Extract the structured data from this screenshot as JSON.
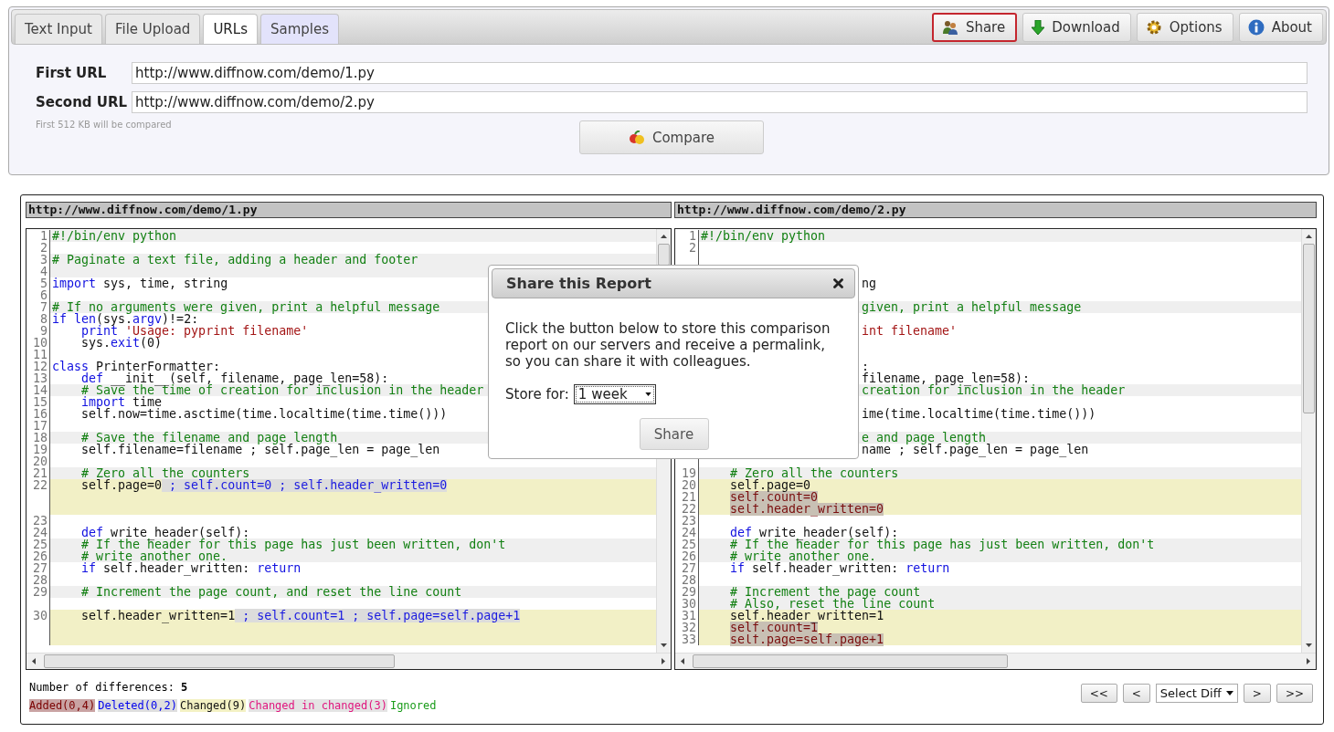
{
  "tabs": [
    {
      "label": "Text Input",
      "selected": false,
      "hovered": false
    },
    {
      "label": "File Upload",
      "selected": false,
      "hovered": false
    },
    {
      "label": "URLs",
      "selected": true,
      "hovered": false
    },
    {
      "label": "Samples",
      "selected": false,
      "hovered": true
    }
  ],
  "actions": [
    {
      "kind": "share",
      "label": "Share",
      "highlighted": true
    },
    {
      "kind": "download",
      "label": "Download",
      "highlighted": false
    },
    {
      "kind": "options",
      "label": "Options",
      "highlighted": false
    },
    {
      "kind": "about",
      "label": "About",
      "highlighted": false
    }
  ],
  "url_form": {
    "fields": [
      {
        "label": "First URL",
        "value": "http://www.diffnow.com/demo/1.py"
      },
      {
        "label": "Second URL",
        "value": "http://www.diffnow.com/demo/2.py"
      }
    ],
    "note": "First 512 KB will be compared",
    "compare_button": "Compare"
  },
  "panels": [
    {
      "title": "http://www.diffnow.com/demo/1.py",
      "rows": [
        {
          "num": "1",
          "kind": "comment",
          "segs": [
            {
              "kind": "comment",
              "text": "#!/bin/env python"
            }
          ]
        },
        {
          "num": "2",
          "kind": "plain"
        },
        {
          "num": "3",
          "kind": "comment",
          "segs": [
            {
              "kind": "comment",
              "text": "# Paginate a text file, adding a header and footer"
            }
          ]
        },
        {
          "num": "4",
          "kind": "comment"
        },
        {
          "num": "5",
          "kind": "plain",
          "segs": [
            {
              "kind": "keyword",
              "text": "import"
            },
            {
              "kind": "plain",
              "text": " sys, time, string"
            }
          ]
        },
        {
          "num": "6",
          "kind": "plain"
        },
        {
          "num": "7",
          "kind": "comment",
          "segs": [
            {
              "kind": "comment",
              "text": "# If no arguments were given, print a helpful message"
            }
          ]
        },
        {
          "num": "8",
          "kind": "plain",
          "segs": [
            {
              "kind": "keyword",
              "text": "if len"
            },
            {
              "kind": "plain",
              "text": "(sys."
            },
            {
              "kind": "keyword",
              "text": "argv"
            },
            {
              "kind": "plain",
              "text": ")!=2:"
            }
          ]
        },
        {
          "num": "9",
          "kind": "plain",
          "segs": [
            {
              "kind": "keyword",
              "text": "    print"
            },
            {
              "kind": "string",
              "text": " 'Usage: pyprint filename'"
            }
          ]
        },
        {
          "num": "10",
          "kind": "plain",
          "segs": [
            {
              "kind": "plain",
              "text": "    sys."
            },
            {
              "kind": "keyword",
              "text": "exit"
            },
            {
              "kind": "plain",
              "text": "(0)"
            }
          ]
        },
        {
          "num": "11",
          "kind": "plain"
        },
        {
          "num": "12",
          "kind": "plain",
          "segs": [
            {
              "kind": "keyword",
              "text": "class"
            },
            {
              "kind": "plain",
              "text": " PrinterFormatter:"
            }
          ]
        },
        {
          "num": "13",
          "kind": "plain",
          "segs": [
            {
              "kind": "keyword",
              "text": "    def"
            },
            {
              "kind": "plain",
              "text": " __init__(self, filename, page_len=58):"
            }
          ]
        },
        {
          "num": "14",
          "kind": "comment",
          "segs": [
            {
              "kind": "comment",
              "text": "    # Save the time of creation for inclusion in the header"
            }
          ]
        },
        {
          "num": "15",
          "kind": "plain",
          "segs": [
            {
              "kind": "keyword",
              "text": "    import"
            },
            {
              "kind": "plain",
              "text": " time"
            }
          ]
        },
        {
          "num": "16",
          "kind": "plain",
          "segs": [
            {
              "kind": "plain",
              "text": "    self.now=time.asctime(time.localtime(time.time()))"
            }
          ]
        },
        {
          "num": "17",
          "kind": "plain"
        },
        {
          "num": "18",
          "kind": "comment",
          "segs": [
            {
              "kind": "comment",
              "text": "    # Save the filename and page length"
            }
          ]
        },
        {
          "num": "19",
          "kind": "plain",
          "segs": [
            {
              "kind": "plain",
              "text": "    self.filename=filename ; self.page_len = page_len"
            }
          ]
        },
        {
          "num": "20",
          "kind": "plain"
        },
        {
          "num": "21",
          "kind": "comment",
          "segs": [
            {
              "kind": "comment",
              "text": "    # Zero all the counters"
            }
          ]
        },
        {
          "num": "22",
          "kind": "changed",
          "segs": [
            {
              "kind": "plain",
              "text": "    self.page=0"
            },
            {
              "kind": "deleted",
              "text": " ; self.count=0 ; self.header_written=0"
            }
          ]
        },
        {
          "kind": "changed"
        },
        {
          "kind": "changed"
        },
        {
          "num": "23",
          "kind": "plain"
        },
        {
          "num": "24",
          "kind": "plain",
          "segs": [
            {
              "kind": "keyword",
              "text": "    def"
            },
            {
              "kind": "plain",
              "text": " write_header(self):"
            }
          ]
        },
        {
          "num": "25",
          "kind": "comment",
          "segs": [
            {
              "kind": "comment",
              "text": "    # If the header for this page has just been written, don't"
            }
          ]
        },
        {
          "num": "26",
          "kind": "comment",
          "segs": [
            {
              "kind": "comment",
              "text": "    # write another one."
            }
          ]
        },
        {
          "num": "27",
          "kind": "plain",
          "segs": [
            {
              "kind": "keyword",
              "text": "    if"
            },
            {
              "kind": "plain",
              "text": " self.header_written: "
            },
            {
              "kind": "keyword",
              "text": "return"
            }
          ]
        },
        {
          "num": "28",
          "kind": "plain"
        },
        {
          "num": "29",
          "kind": "comment",
          "segs": [
            {
              "kind": "comment",
              "text": "    # Increment the page count, and reset the line count"
            }
          ]
        },
        {
          "kind": "plain"
        },
        {
          "num": "30",
          "kind": "changed",
          "segs": [
            {
              "kind": "plain",
              "text": "    self.header_written=1"
            },
            {
              "kind": "deleted",
              "text": " ; self.count=1 ; self.page=self.page+1"
            }
          ]
        },
        {
          "kind": "changed"
        },
        {
          "kind": "changed"
        }
      ]
    },
    {
      "title": "http://www.diffnow.com/demo/2.py",
      "rows": [
        {
          "num": "1",
          "kind": "comment",
          "segs": [
            {
              "kind": "comment",
              "text": "#!/bin/env python"
            }
          ]
        },
        {
          "num": "2",
          "kind": "plain"
        },
        {
          "kind": "plain"
        },
        {
          "kind": "plain"
        },
        {
          "clipped": true,
          "kind": "plain",
          "segs": [
            {
              "kind": "plain",
              "text": "ng"
            }
          ]
        },
        {
          "kind": "plain"
        },
        {
          "clipped": true,
          "kind": "comment",
          "segs": [
            {
              "kind": "comment",
              "text": "given, print a helpful message"
            }
          ]
        },
        {
          "kind": "plain"
        },
        {
          "clipped": true,
          "kind": "plain",
          "segs": [
            {
              "kind": "string",
              "text": "int filename'"
            }
          ]
        },
        {
          "kind": "plain"
        },
        {
          "kind": "plain"
        },
        {
          "clipped": true,
          "kind": "plain",
          "segs": [
            {
              "kind": "plain",
              "text": ":"
            }
          ]
        },
        {
          "clipped": true,
          "kind": "plain",
          "segs": [
            {
              "kind": "plain",
              "text": "filename, page_len=58):"
            }
          ]
        },
        {
          "clipped": true,
          "kind": "comment",
          "segs": [
            {
              "kind": "comment",
              "text": "creation for inclusion in the header"
            }
          ]
        },
        {
          "kind": "plain"
        },
        {
          "clipped": true,
          "kind": "plain",
          "segs": [
            {
              "kind": "plain",
              "text": "ime(time.localtime(time.time()))"
            }
          ]
        },
        {
          "kind": "plain"
        },
        {
          "clipped": true,
          "kind": "comment",
          "segs": [
            {
              "kind": "comment",
              "text": "e and page length"
            }
          ]
        },
        {
          "clipped": true,
          "kind": "plain",
          "segs": [
            {
              "kind": "plain",
              "text": "name ; self.page_len = page_len"
            }
          ]
        },
        {
          "kind": "plain"
        },
        {
          "num": "19",
          "kind": "comment",
          "segs": [
            {
              "kind": "comment",
              "text": "    # Zero all the counters"
            }
          ]
        },
        {
          "num": "20",
          "kind": "changed",
          "segs": [
            {
              "kind": "plain",
              "text": "    self.page=0"
            }
          ]
        },
        {
          "num": "21",
          "kind": "changed",
          "indented": true,
          "segs": [
            {
              "kind": "added",
              "text": "self.count=0"
            }
          ]
        },
        {
          "num": "22",
          "kind": "changed",
          "indented": true,
          "segs": [
            {
              "kind": "added",
              "text": "self.header_written=0"
            }
          ]
        },
        {
          "num": "23",
          "kind": "plain"
        },
        {
          "num": "24",
          "kind": "plain",
          "segs": [
            {
              "kind": "keyword",
              "text": "    def"
            },
            {
              "kind": "plain",
              "text": " write_header(self):"
            }
          ]
        },
        {
          "num": "25",
          "kind": "comment",
          "segs": [
            {
              "kind": "comment",
              "text": "    # If the header for this page has just been written, don't"
            }
          ]
        },
        {
          "num": "26",
          "kind": "comment",
          "segs": [
            {
              "kind": "comment",
              "text": "    # write another one."
            }
          ]
        },
        {
          "num": "27",
          "kind": "plain",
          "segs": [
            {
              "kind": "keyword",
              "text": "    if"
            },
            {
              "kind": "plain",
              "text": " self.header_written: "
            },
            {
              "kind": "keyword",
              "text": "return"
            }
          ]
        },
        {
          "num": "28",
          "kind": "plain"
        },
        {
          "num": "29",
          "kind": "comment",
          "segs": [
            {
              "kind": "comment",
              "text": "    # Increment the page count"
            }
          ]
        },
        {
          "num": "30",
          "kind": "comment",
          "segs": [
            {
              "kind": "comment",
              "text": "    # Also, reset the line count"
            }
          ]
        },
        {
          "num": "31",
          "kind": "changed",
          "segs": [
            {
              "kind": "plain",
              "text": "    self.header_written=1"
            }
          ]
        },
        {
          "num": "32",
          "kind": "changed",
          "indented": true,
          "segs": [
            {
              "kind": "added",
              "text": "self.count=1"
            }
          ]
        },
        {
          "num": "33",
          "kind": "changed",
          "indented": true,
          "segs": [
            {
              "kind": "added",
              "text": "self.page=self.page+1"
            }
          ]
        }
      ]
    }
  ],
  "summary": {
    "label": "Number of differences:",
    "count": "5"
  },
  "legend": [
    {
      "kind": "added",
      "label": "Added(0,4)"
    },
    {
      "kind": "deleted",
      "label": "Deleted(0,2)"
    },
    {
      "kind": "changed",
      "label": "Changed(9)"
    },
    {
      "kind": "changed-in-changed",
      "label": "Changed in changed(3)"
    },
    {
      "kind": "ignored",
      "label": "Ignored"
    }
  ],
  "nav": [
    {
      "kind": "button",
      "label": "<<"
    },
    {
      "kind": "button",
      "label": "<"
    },
    {
      "kind": "select",
      "label": "Select Diff"
    },
    {
      "kind": "button",
      "label": ">"
    },
    {
      "kind": "button",
      "label": ">>"
    }
  ],
  "dialog": {
    "title": "Share this Report",
    "message": "Click the button below to store this comparison report on our servers and receive a permalink, so you can share it with colleagues.",
    "store_label": "Store for:",
    "store_value": "1 week",
    "button": "Share"
  }
}
